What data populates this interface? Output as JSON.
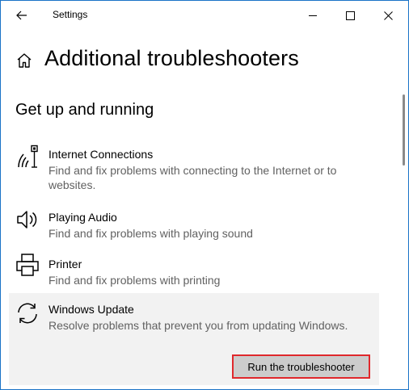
{
  "window": {
    "title": "Settings",
    "controls": {
      "minimize": "minimize-icon",
      "maximize": "maximize-icon",
      "close": "close-icon"
    }
  },
  "page": {
    "title": "Additional troubleshooters",
    "section_title": "Get up and running"
  },
  "items": [
    {
      "name": "Internet Connections",
      "desc": "Find and fix problems with connecting to the Internet or to websites.",
      "icon": "wifi-icon"
    },
    {
      "name": "Playing Audio",
      "desc": "Find and fix problems with playing sound",
      "icon": "speaker-icon"
    },
    {
      "name": "Printer",
      "desc": "Find and fix problems with printing",
      "icon": "printer-icon"
    },
    {
      "name": "Windows Update",
      "desc": "Resolve problems that prevent you from updating Windows.",
      "icon": "sync-icon"
    }
  ],
  "run_button": {
    "label": "Run the troubleshooter"
  },
  "colors": {
    "accent_border": "#e0282c",
    "window_border": "#1a73c7",
    "selected_bg": "#f2f2f2"
  }
}
